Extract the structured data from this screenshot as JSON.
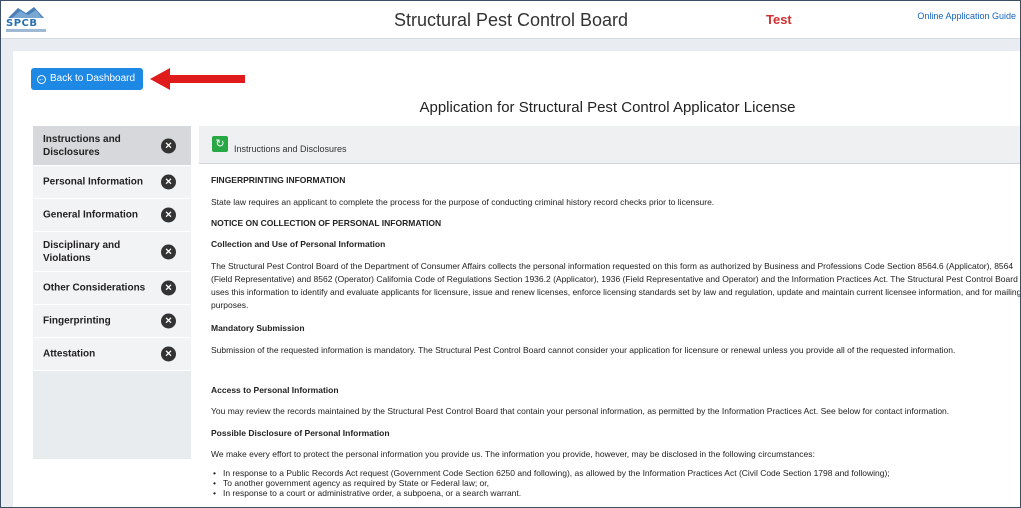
{
  "header": {
    "logo_text": "SPCB",
    "title": "Structural Pest Control Board",
    "environment": "Test",
    "guide_link": "Online Application Guide"
  },
  "back_button": {
    "label": "Back to Dashboard"
  },
  "page_title": "Application for Structural Pest Control Applicator License",
  "sidebar": {
    "items": [
      {
        "label": "Instructions and Disclosures",
        "status": "close-icon"
      },
      {
        "label": "Personal Information",
        "status": "close-icon"
      },
      {
        "label": "General Information",
        "status": "close-icon"
      },
      {
        "label": "Disciplinary and Violations",
        "status": "close-icon"
      },
      {
        "label": "Other Considerations",
        "status": "close-icon"
      },
      {
        "label": "Fingerprinting",
        "status": "close-icon"
      },
      {
        "label": "Attestation",
        "status": "close-icon"
      }
    ]
  },
  "section": {
    "header_label": "Instructions and Disclosures",
    "h1": "FINGERPRINTING INFORMATION",
    "p1": "State law requires an applicant to complete the process for the purpose of conducting criminal history record checks prior to licensure.",
    "h2": "NOTICE ON COLLECTION OF PERSONAL INFORMATION",
    "h3": "Collection and Use of Personal Information",
    "p2": "The Structural Pest Control Board of the Department of Consumer Affairs collects the personal information requested on this form as authorized by Business and Professions Code Section 8564.6 (Applicator), 8564 (Field Representative) and 8562 (Operator) California Code of Regulations Section 1936.2 (Applicator), 1936 (Field Representative and Operator) and the Information Practices Act. The Structural Pest Control Board uses this information to identify and evaluate applicants for licensure, issue and renew licenses, enforce licensing standards set by law and regulation, update and maintain current licensee information, and for mailing purposes.",
    "h4": "Mandatory Submission",
    "p3": "Submission of the requested information is mandatory. The Structural Pest Control Board cannot consider your application for licensure or renewal unless you provide all of the requested information.",
    "h5": "Access to Personal Information",
    "p4": "You may review the records maintained by the Structural Pest Control Board that contain your personal information, as permitted by the Information Practices Act. See below for contact information.",
    "h6": "Possible Disclosure of Personal Information",
    "p5": "We make every effort to protect the personal information you provide us. The information you provide, however, may be disclosed in the following circumstances:",
    "bullets": [
      "In response to a Public Records Act request (Government Code Section 6250 and following), as allowed by the Information Practices Act (Civil Code Section 1798 and following);",
      "To another government agency as required by State or Federal law; or,",
      "In response to a court or administrative order, a subpoena, or a search warrant."
    ]
  },
  "colors": {
    "primary": "#1e88e5",
    "env": "#d32f2f",
    "success": "#28a745",
    "arrow": "#e01b1b"
  }
}
